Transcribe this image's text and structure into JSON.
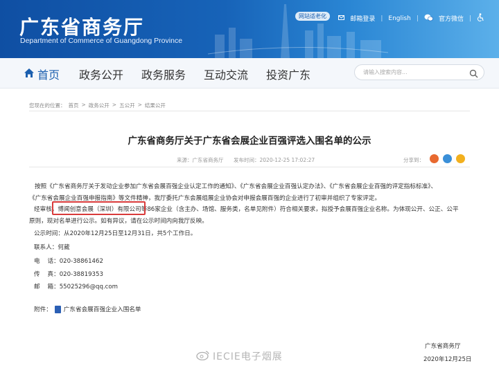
{
  "header": {
    "site_title": "广东省商务厅",
    "site_subtitle": "Department of Commerce of Guangdong Province",
    "elderly_mode": "网站适老化",
    "links": {
      "mail": "邮箱登录",
      "english": "English",
      "wechat": "官方微信"
    }
  },
  "nav": {
    "items": [
      "首页",
      "政务公开",
      "政务服务",
      "互动交流",
      "投资广东"
    ],
    "search_placeholder": "请输入搜索内容..."
  },
  "breadcrumb": {
    "label": "您现在的位置：",
    "items": [
      "首页",
      "政务公开",
      "五公开",
      "结果公开"
    ],
    "separator": ">"
  },
  "article": {
    "title": "广东省商务厅关于广东省会展企业百强评选入围名单的公示",
    "source_label": "来源：",
    "source": "广东省商务厅",
    "time_label": "发布时间：",
    "time": "2020-12-25 17:02:27",
    "share_label": "分享到：",
    "para1_line1": "按照《广东省商务厅关于发动企业参加广东省会展百强企业认定工作的通知》、《广东省会展企业百强认定办法》、《广东省会展企业百强的评定指标标准》、",
    "para1_line2": "《广东省会展企业百强申报指南》等文件精神，我厅委托广东会展组展企业协会对申报会展百强的企业进行了初审并组织了专家评定。",
    "para2_prefix": "经审核，",
    "para2_highlight": "博闻创意会展（深圳）有限公司",
    "para2_rest": "等86家企业（含主办、场馆、服务类，名单见附件）符合相关要求，拟授予会展百强企业名称。为体现公开、公正、公平",
    "para2_line2": "原则，现对名单进行公示。如有异议，请在公示时间内向我厅反映。",
    "period": "公示时间：从2020年12月25日至12月31日，共5个工作日。",
    "contact": "联系人：何葳",
    "phone": "电    话：020-38861462",
    "fax": "传    真：020-38819353",
    "email": "邮    箱：55025296@qq.com",
    "attachment_label": "附件：",
    "attachment": "广东省会展百强企业入围名单",
    "sign_org": "广东省商务厅",
    "sign_date": "2020年12月25日"
  },
  "watermark": "IECIE电子烟展",
  "colors": {
    "brand": "#1763b8",
    "highlight": "#d93a3a"
  }
}
